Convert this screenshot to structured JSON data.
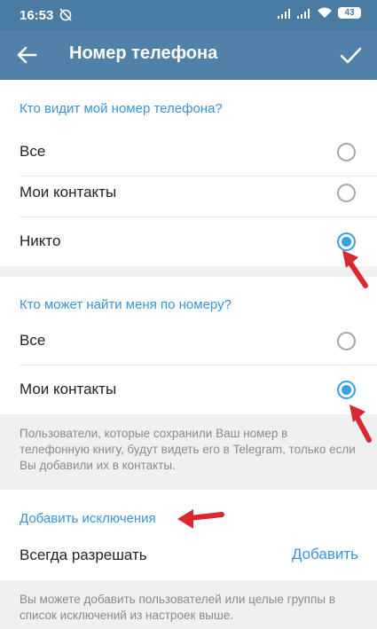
{
  "status_bar": {
    "time": "16:53",
    "battery": "43"
  },
  "app_bar": {
    "title": "Номер телефона"
  },
  "section_visibility": {
    "title": "Кто видит мой номер телефона?",
    "options": [
      {
        "label": "Все",
        "selected": false
      },
      {
        "label": "Мои контакты",
        "selected": false
      },
      {
        "label": "Никто",
        "selected": true
      }
    ]
  },
  "section_find": {
    "title": "Кто может найти меня по номеру?",
    "options": [
      {
        "label": "Все",
        "selected": false
      },
      {
        "label": "Мои контакты",
        "selected": true
      }
    ],
    "note": "Пользователи, которые сохранили Ваш номер в телефонную книгу, будут видеть его в Telegram, только если Вы добавили их в контакты."
  },
  "exceptions": {
    "title": "Добавить исключения",
    "always_allow_label": "Всегда разрешать",
    "add_label": "Добавить",
    "note": "Вы можете добавить пользователей или целые группы в список исключений из настроек выше."
  },
  "colors": {
    "accent": "#36a0e4",
    "app_bar": "#5181a8",
    "annotation_arrow": "#d9282f"
  }
}
